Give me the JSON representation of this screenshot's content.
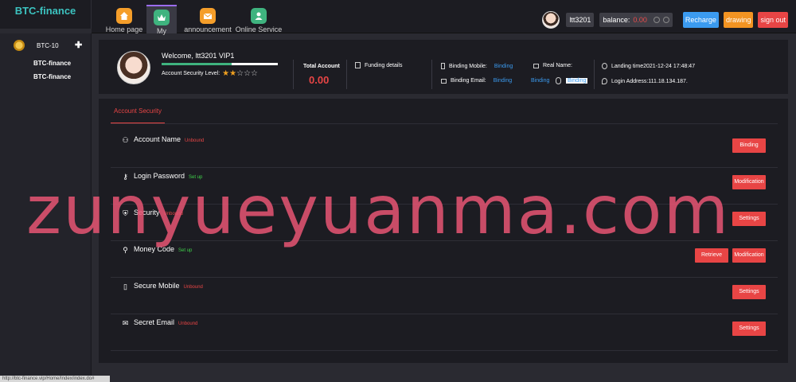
{
  "brand": "BTC-finance",
  "nav": [
    {
      "label": "Home page",
      "icon": "home-icon"
    },
    {
      "label": "My",
      "icon": "crown-icon"
    },
    {
      "label": "announcement",
      "icon": "mail-icon"
    },
    {
      "label": "Online Service",
      "icon": "person-icon"
    }
  ],
  "top": {
    "username": "ltt3201",
    "balance_label": "balance:",
    "balance_value": "0.00",
    "recharge": "Recharge",
    "drawing": "drawing",
    "signout": "sign out"
  },
  "sidebar": {
    "title": "BTC-10",
    "links": [
      "BTC-finance",
      "BTC-finance"
    ]
  },
  "profile": {
    "welcome": "Welcome, ltt3201 VIP1",
    "security_level_label": "Account Security Level:",
    "security_bar_fraction": 0.6,
    "stars_on": 2,
    "stars_total": 5,
    "total_account_label": "Total Account",
    "total_account_value": "0.00",
    "funding_details": "Funding details",
    "binding_mobile_label": "Binding Mobile:",
    "binding_mobile_link": "Binding",
    "binding_email_label": "Binding Email:",
    "binding_email_link": "Binding",
    "binding_extra_link": "Binding",
    "binding_qq_link": "Binding",
    "real_name_label": "Real Name:",
    "landing_time": "Landing time2021-12-24 17:48:47",
    "login_address": "Login Address:111.18.134.187."
  },
  "security": {
    "tab": "Account Security",
    "rows": [
      {
        "label": "Account Name",
        "status": "Unbound",
        "status_color": "red",
        "buttons": [
          "Binding"
        ],
        "icon": "user-icon"
      },
      {
        "label": "Login Password",
        "status": "Set up",
        "status_color": "green",
        "buttons": [
          "Modification"
        ],
        "icon": "lock-icon"
      },
      {
        "label": "Security",
        "status": "Unbound",
        "status_color": "red",
        "buttons": [
          "Settings"
        ],
        "icon": "shield-icon"
      },
      {
        "label": "Money Code",
        "status": "Set up",
        "status_color": "green",
        "buttons": [
          "Retrieve",
          "Modification"
        ],
        "icon": "moneybag-icon"
      },
      {
        "label": "Secure Mobile",
        "status": "Unbound",
        "status_color": "red",
        "buttons": [
          "Settings"
        ],
        "icon": "mobile-icon"
      },
      {
        "label": "Secret Email",
        "status": "Unbound",
        "status_color": "red",
        "buttons": [
          "Settings"
        ],
        "icon": "mail-icon"
      }
    ]
  },
  "watermark": "zunyueyuanma.com",
  "statusbar": "http://btc-finance.vip/Home/Index/index.do#"
}
